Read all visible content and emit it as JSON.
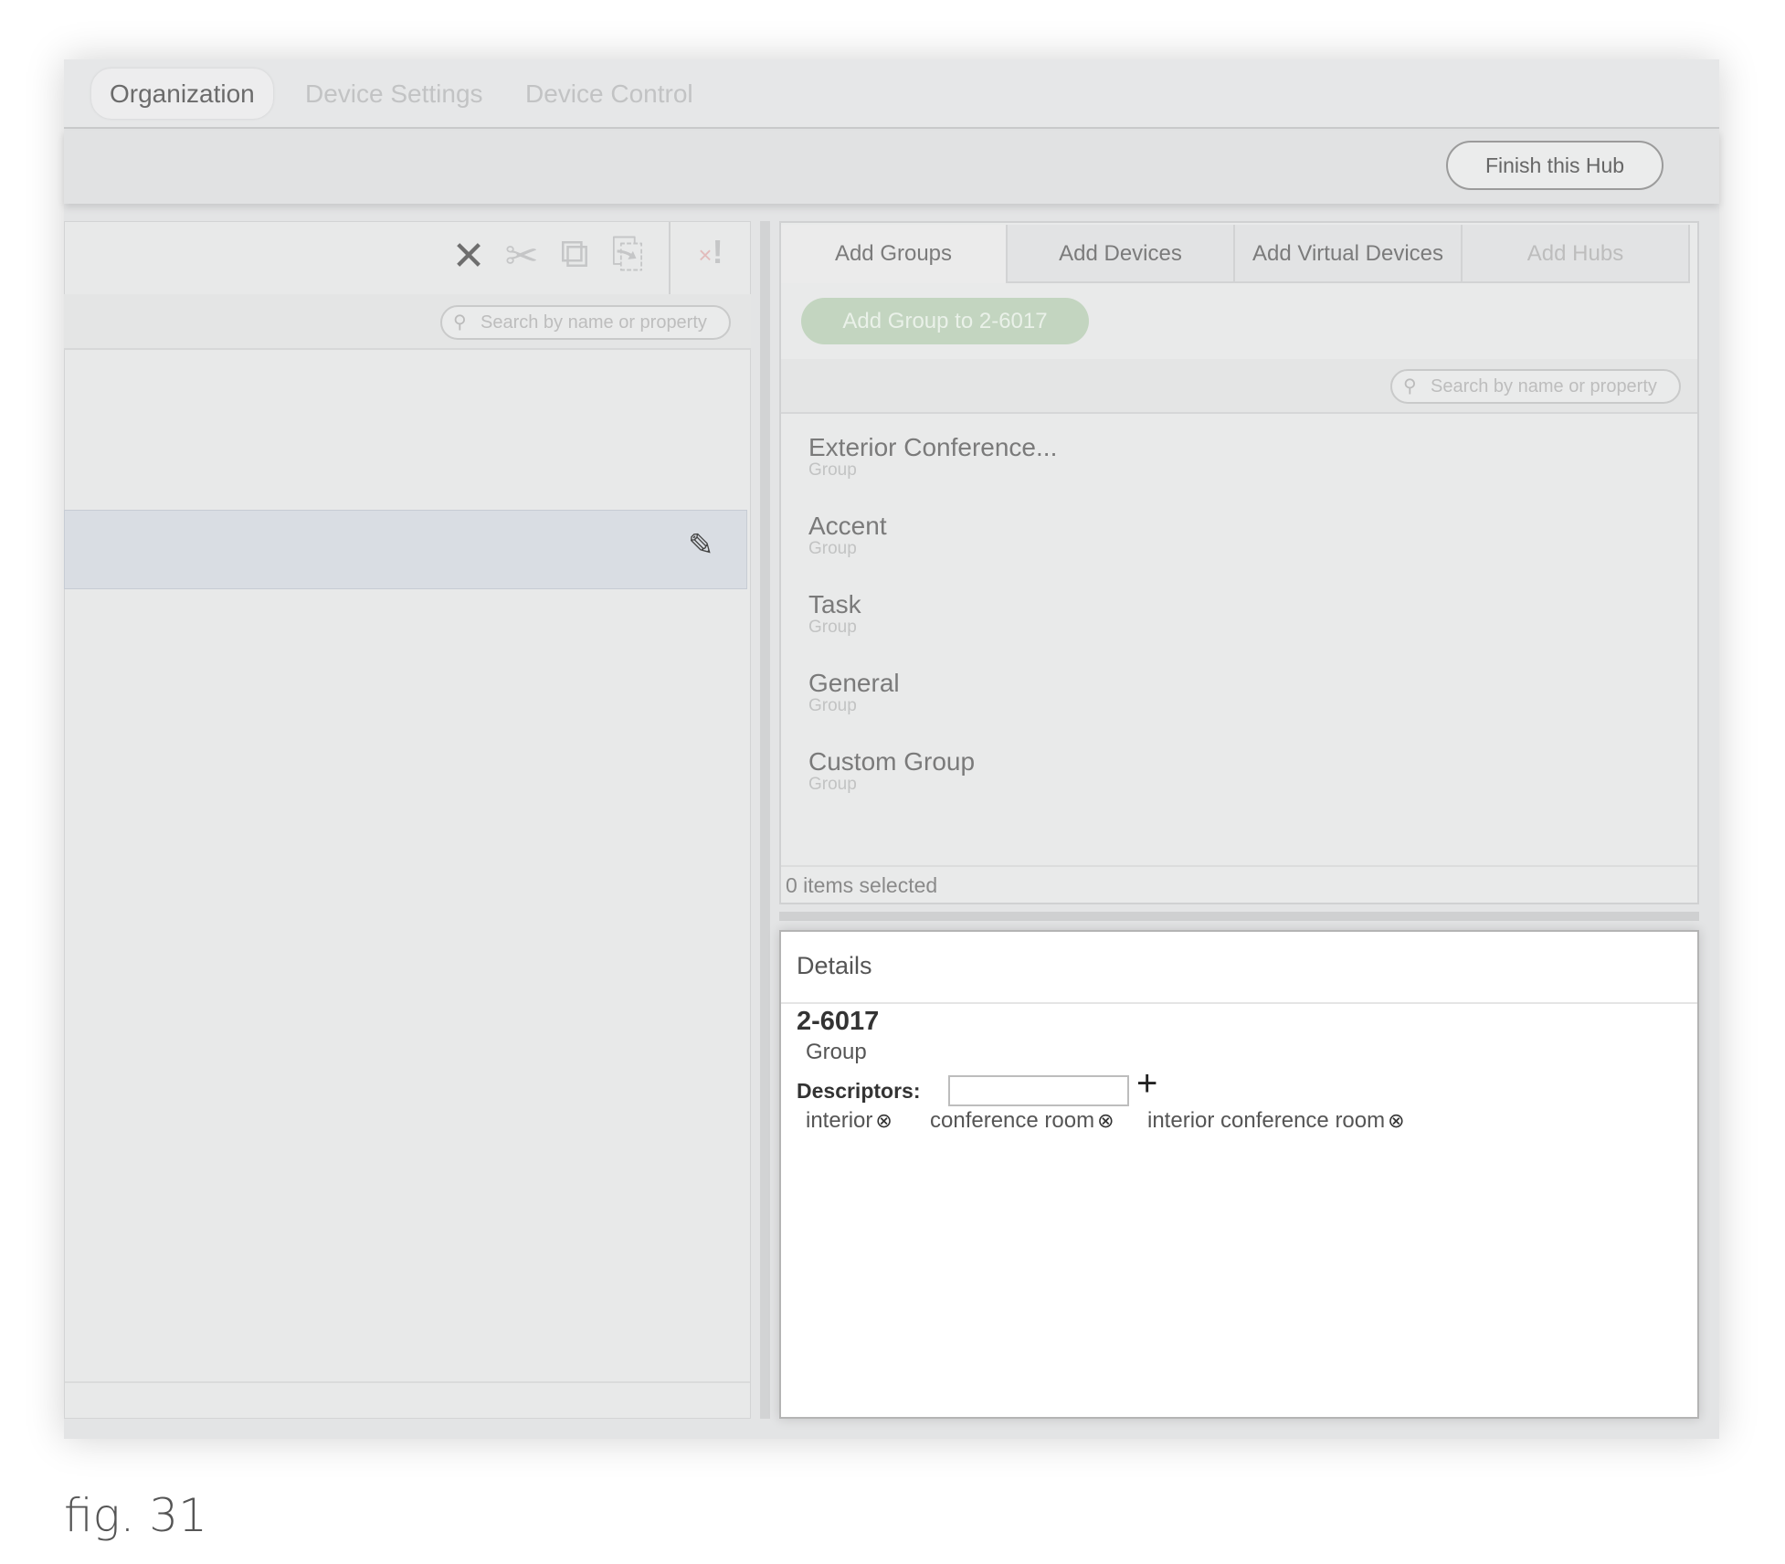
{
  "top_tabs": [
    {
      "label": "Organization",
      "active": true
    },
    {
      "label": "Device Settings"
    },
    {
      "label": "Device Control"
    }
  ],
  "toolbar": {
    "finish_label": "Finish this Hub"
  },
  "left_panel": {
    "icons": [
      "close-icon",
      "cut-icon",
      "copy-icon",
      "paste-icon",
      "clear-errors-icon"
    ],
    "search_placeholder": "Search by name or property",
    "edit_icon": "pencil-icon"
  },
  "right_panel": {
    "tabs": [
      {
        "label": "Add Groups",
        "active": true
      },
      {
        "label": "Add Devices"
      },
      {
        "label": "Add Virtual Devices"
      },
      {
        "label": "Add Hubs",
        "disabled": true
      }
    ],
    "add_button": "Add Group to 2-6017",
    "search_placeholder": "Search by name or property",
    "items": [
      {
        "name": "Exterior Conference...",
        "type": "Group"
      },
      {
        "name": "Accent",
        "type": "Group"
      },
      {
        "name": "Task",
        "type": "Group"
      },
      {
        "name": "General",
        "type": "Group"
      },
      {
        "name": "Custom Group",
        "type": "Group"
      }
    ],
    "footer": "0 items selected"
  },
  "details": {
    "title": "Details",
    "name": "2-6017",
    "type": "Group",
    "descriptors_label": "Descriptors:",
    "descriptor_input": "",
    "add_icon": "+",
    "remove_icon": "⊗",
    "descriptors": [
      "interior",
      "conference room",
      "interior conference room"
    ]
  },
  "caption": "fig. 31",
  "colors": {
    "add_button": "#c3d5c0",
    "background": "#e3e4e5",
    "selected_row": "#d9dde3"
  }
}
